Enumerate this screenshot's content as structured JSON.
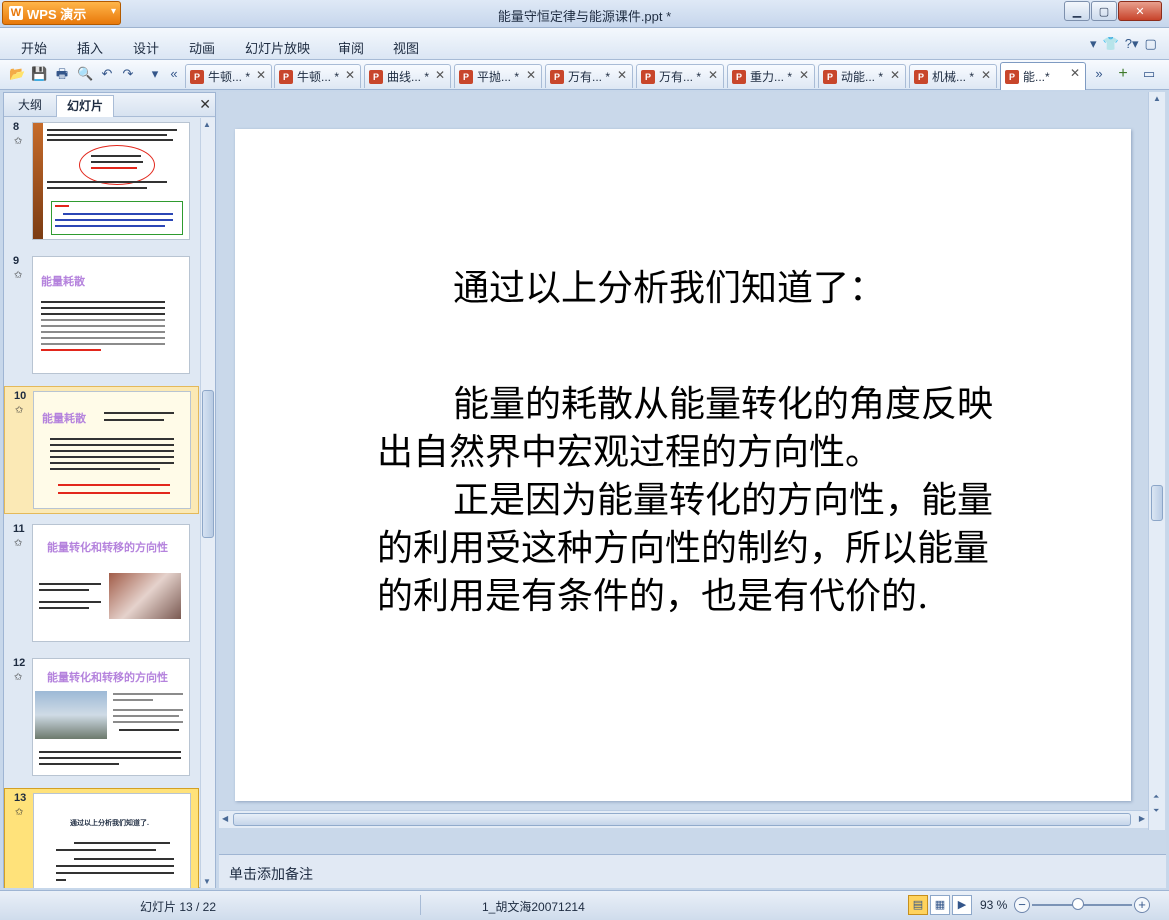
{
  "app": {
    "button_label": "WPS 演示",
    "doc_title": "能量守恒定律与能源课件.ppt *"
  },
  "menu": [
    "开始",
    "插入",
    "设计",
    "动画",
    "幻灯片放映",
    "审阅",
    "视图"
  ],
  "tabs": [
    {
      "label": "牛顿... *"
    },
    {
      "label": "牛顿... *"
    },
    {
      "label": "曲线... *"
    },
    {
      "label": "平抛... *"
    },
    {
      "label": "万有... *"
    },
    {
      "label": "万有... *"
    },
    {
      "label": "重力... *"
    },
    {
      "label": "动能... *"
    },
    {
      "label": "机械... *"
    },
    {
      "label": "能...*"
    }
  ],
  "left_pane": {
    "tab_outline": "大纲",
    "tab_slides": "幻灯片",
    "thumbs": [
      {
        "num": "8"
      },
      {
        "num": "9",
        "heading": "能量耗散"
      },
      {
        "num": "10",
        "heading": "能量耗散"
      },
      {
        "num": "11",
        "heading": "能量转化和转移的方向性"
      },
      {
        "num": "12",
        "heading": "能量转化和转移的方向性"
      },
      {
        "num": "13",
        "heading": "通过以上分析我们知道了."
      }
    ]
  },
  "slide": {
    "title": "通过以上分析我们知道了：",
    "para1": "能量的耗散从能量转化的角度反映出自然界中宏观过程的方向性。",
    "para2": "正是因为能量转化的方向性，能量的利用受这种方向性的制约，所以能量的利用是有条件的，也是有代价的."
  },
  "notes_placeholder": "单击添加备注",
  "status": {
    "slide_counter": "幻灯片 13 / 22",
    "template_name": "1_胡文海20071214",
    "zoom": "93 %"
  }
}
